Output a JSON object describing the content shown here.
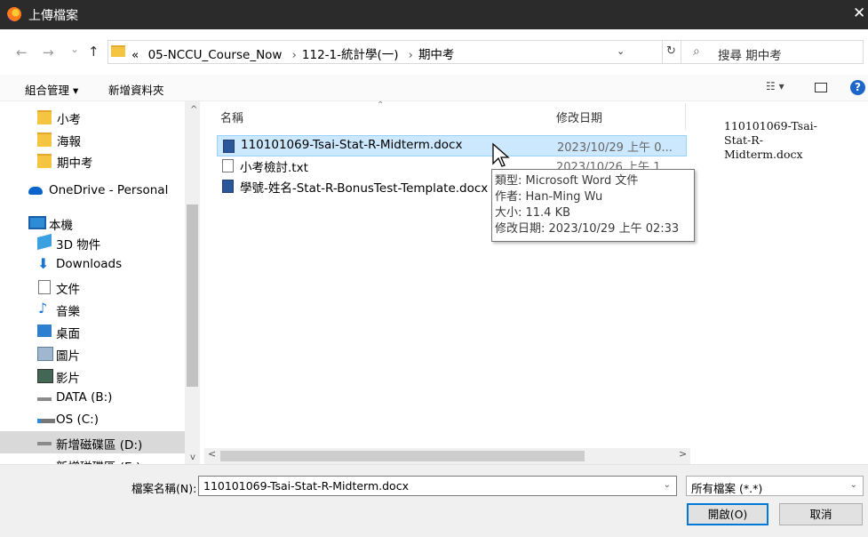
{
  "window": {
    "title": "上傳檔案",
    "close_glyph": "✕"
  },
  "nav": {
    "back": "←",
    "forward": "→",
    "recent": "⌄",
    "up": "↑"
  },
  "address": {
    "overflow": "«",
    "crumbs": [
      "05-NCCU_Course_Now",
      "112-1-統計學(一)",
      "期中考"
    ],
    "separator": "›",
    "dropdown_glyph": "⌄",
    "refresh_glyph": "↻"
  },
  "search": {
    "placeholder": "搜尋 期中考",
    "icon": "search-icon"
  },
  "toolbar": {
    "organize_label": "組合管理 ▾",
    "new_folder_label": "新增資料夾",
    "view_label": "☷ ▾",
    "help_label": "?"
  },
  "sidebar": {
    "items": [
      {
        "label": "小考",
        "icon": "folder-icon"
      },
      {
        "label": "海報",
        "icon": "folder-icon"
      },
      {
        "label": "期中考",
        "icon": "folder-icon"
      },
      {
        "label": "OneDrive - Personal",
        "icon": "cloud-icon"
      },
      {
        "label": "本機",
        "icon": "pc-icon"
      },
      {
        "label": "3D 物件",
        "icon": "3d-objects-icon"
      },
      {
        "label": "Downloads",
        "icon": "download-icon"
      },
      {
        "label": "文件",
        "icon": "document-icon"
      },
      {
        "label": "音樂",
        "icon": "music-icon"
      },
      {
        "label": "桌面",
        "icon": "desktop-icon"
      },
      {
        "label": "圖片",
        "icon": "pictures-icon"
      },
      {
        "label": "影片",
        "icon": "videos-icon"
      },
      {
        "label": "DATA (B:)",
        "icon": "drive-icon"
      },
      {
        "label": "OS (C:)",
        "icon": "os-drive-icon"
      },
      {
        "label": "新增磁碟區 (D:)",
        "icon": "drive-icon"
      },
      {
        "label": "新增磁碟區 (E:)",
        "icon": "drive-icon"
      }
    ]
  },
  "filelist": {
    "columns": {
      "name": "名稱",
      "date": "修改日期"
    },
    "sort_glyph": "⌃",
    "rows": [
      {
        "name": "110101069-Tsai-Stat-R-Midterm.docx",
        "date": "2023/10/29 上午 0...",
        "type": "word"
      },
      {
        "name": "小考檢討.txt",
        "date": "2023/10/26 上午 1...",
        "type": "text"
      },
      {
        "name": "學號-姓名-Stat-R-BonusTest-Template.docx",
        "date": "",
        "type": "word"
      }
    ]
  },
  "tooltip": {
    "type": "類型: Microsoft Word 文件",
    "author": "作者: Han-Ming Wu",
    "size": "大小: 11.4 KB",
    "modified": "修改日期: 2023/10/29 上午 02:33"
  },
  "preview": {
    "text": "110101069-Tsai-Stat-R-Midterm.docx"
  },
  "scroll": {
    "left": "<",
    "right": ">",
    "up": "^",
    "down": "v"
  },
  "filename": {
    "label": "檔案名稱(N):",
    "value": "110101069-Tsai-Stat-R-Midterm.docx",
    "dropdown_glyph": "⌄"
  },
  "filetype": {
    "value": "所有檔案 (*.*)",
    "dropdown_glyph": "⌄"
  },
  "buttons": {
    "open": "開啟(O)",
    "cancel": "取消"
  }
}
